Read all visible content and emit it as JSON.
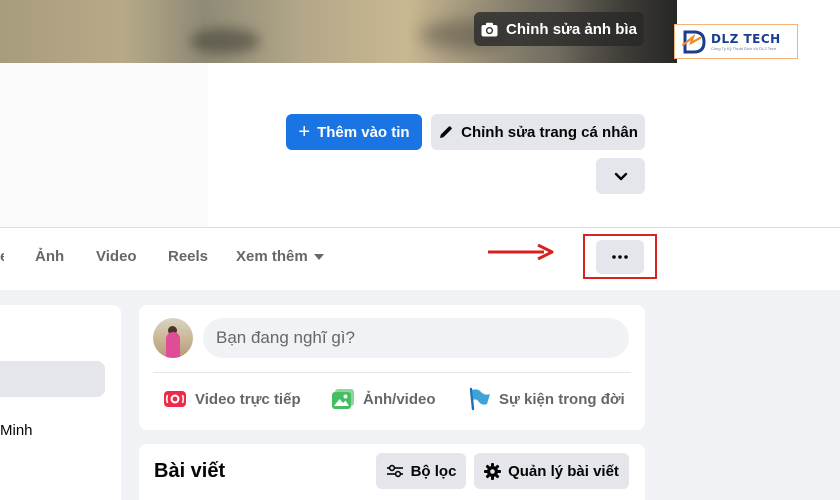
{
  "cover": {
    "edit_cover_label": "Chỉnh sửa ảnh bìa"
  },
  "logo": {
    "name": "DLZ TECH",
    "tagline": "Công Ty Kỹ Thuật Dịch Vụ DLZ Tech",
    "brand_color": "#1b3d8f"
  },
  "profile_actions": {
    "add_story_label": "Thêm vào tin",
    "edit_profile_label": "Chỉnh sửa trang cá nhân"
  },
  "tabs": {
    "cut_label": "e",
    "items": [
      "Ảnh",
      "Video",
      "Reels"
    ],
    "more_label": "Xem thêm"
  },
  "left_panel": {
    "partial_text": "Minh"
  },
  "composer": {
    "placeholder": "Bạn đang nghĩ gì?",
    "actions": [
      "Video trực tiếp",
      "Ảnh/video",
      "Sự kiện trong đời"
    ]
  },
  "posts": {
    "title": "Bài viết",
    "filter_label": "Bộ lọc",
    "manage_label": "Quản lý bài viết"
  },
  "colors": {
    "primary": "#1b74e4",
    "secondary_bg": "#e4e6eb",
    "highlight": "#d9221f",
    "live_video": "#f02849",
    "photo": "#45bd62",
    "life_event": "#3ea4d8"
  }
}
